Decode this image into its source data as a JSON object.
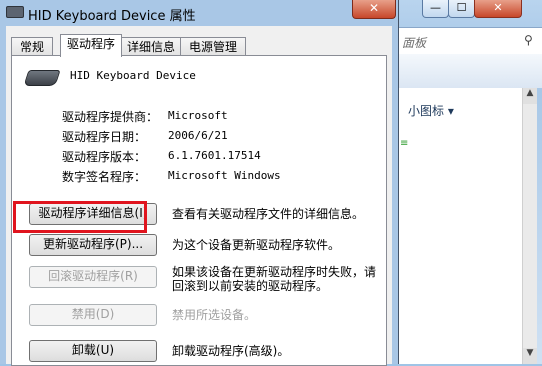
{
  "dialog": {
    "title": "HID Keyboard Device 属性",
    "close_label": "✕",
    "tabs": [
      {
        "label": "常规"
      },
      {
        "label": "驱动程序"
      },
      {
        "label": "详细信息"
      },
      {
        "label": "电源管理"
      }
    ],
    "device_name": "HID Keyboard Device",
    "info": [
      {
        "label": "驱动程序提供商：",
        "value": "Microsoft"
      },
      {
        "label": "驱动程序日期：",
        "value": "2006/6/21"
      },
      {
        "label": "驱动程序版本：",
        "value": "6.1.7601.17514"
      },
      {
        "label": "数字签名程序：",
        "value": "Microsoft Windows"
      }
    ],
    "buttons": [
      {
        "label": "驱动程序详细信息(I)",
        "desc": "查看有关驱动程序文件的详细信息。"
      },
      {
        "label": "更新驱动程序(P)...",
        "desc": "为这个设备更新驱动程序软件。"
      },
      {
        "label": "回滚驱动程序(R)",
        "desc_line1": "如果该设备在更新驱动程序时失败，请",
        "desc_line2": "回滚到以前安装的驱动程序。"
      },
      {
        "label": "禁用(D)",
        "desc": "禁用所选设备。"
      },
      {
        "label": "卸载(U)",
        "desc": "卸载驱动程序(高级)。"
      }
    ]
  },
  "background_window": {
    "min_label": "—",
    "max_label": "☐",
    "close_label": "✕",
    "address_text": "面板",
    "view_label": "小图标 ▾",
    "green_mark": "≡"
  },
  "colors": {
    "highlight": "#e0141e",
    "titlebar": "#a9c7e6",
    "close": "#c7472a"
  }
}
